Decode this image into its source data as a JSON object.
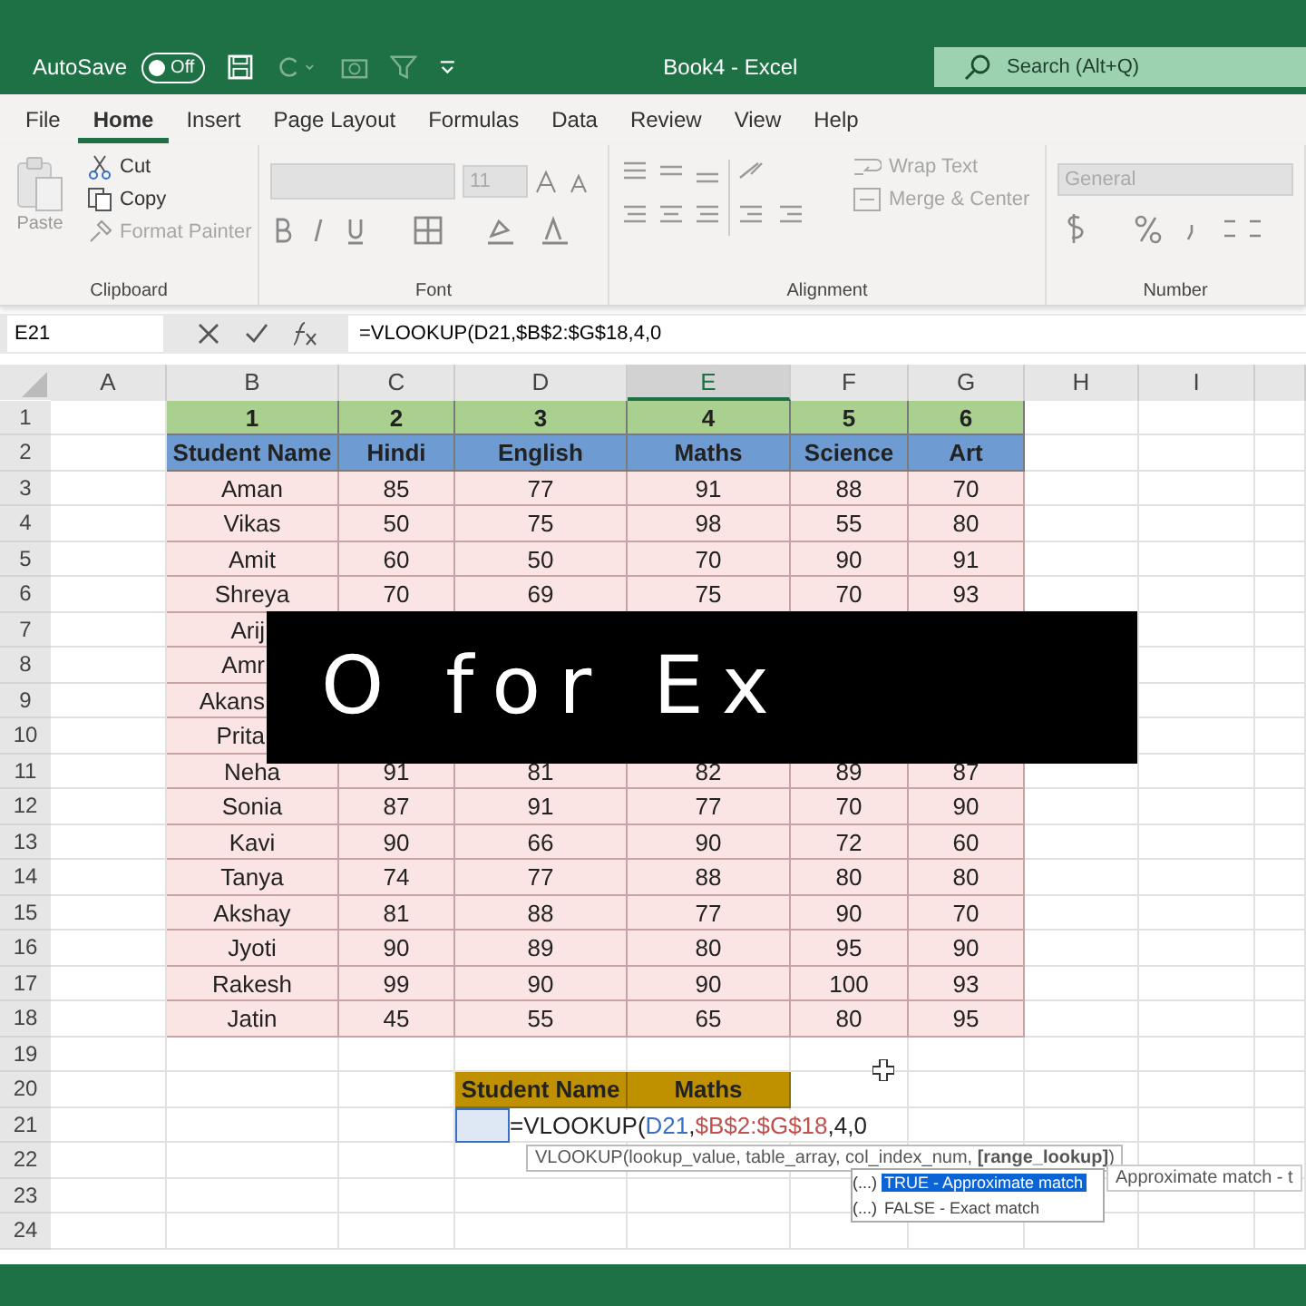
{
  "title_bar": {
    "autosave_label": "AutoSave",
    "autosave_state": "Off",
    "autosave_on": false,
    "title": "Book4 - Excel",
    "search_placeholder": "Search (Alt+Q)"
  },
  "tabs": [
    {
      "label": "File",
      "selected": false
    },
    {
      "label": "Home",
      "selected": true
    },
    {
      "label": "Insert",
      "selected": false
    },
    {
      "label": "Page Layout",
      "selected": false
    },
    {
      "label": "Formulas",
      "selected": false
    },
    {
      "label": "Data",
      "selected": false
    },
    {
      "label": "Review",
      "selected": false
    },
    {
      "label": "View",
      "selected": false
    },
    {
      "label": "Help",
      "selected": false
    }
  ],
  "ribbon": {
    "clipboard": {
      "label": "Clipboard",
      "paste": "Paste",
      "cut": "Cut",
      "copy": "Copy",
      "format_painter": "Format Painter"
    },
    "font": {
      "label": "Font",
      "size": "11"
    },
    "alignment": {
      "label": "Alignment",
      "wrap_text": "Wrap Text",
      "merge": "Merge & Center"
    },
    "number": {
      "label": "Number",
      "format": "General"
    }
  },
  "formula_bar": {
    "name_box": "E21",
    "formula": "=VLOOKUP(D21,$B$2:$G$18,4,0"
  },
  "sheet": {
    "column_letters": [
      {
        "label": "A",
        "selected": false
      },
      {
        "label": "B",
        "selected": false
      },
      {
        "label": "C",
        "selected": false
      },
      {
        "label": "D",
        "selected": false
      },
      {
        "label": "E",
        "selected": true
      },
      {
        "label": "F",
        "selected": false
      },
      {
        "label": "G",
        "selected": false
      },
      {
        "label": "H",
        "selected": false
      },
      {
        "label": "I",
        "selected": false
      }
    ],
    "row_numbers": [
      "1",
      "2",
      "3",
      "4",
      "5",
      "6",
      "7",
      "8",
      "9",
      "10",
      "11",
      "12",
      "13",
      "14",
      "15",
      "16",
      "17",
      "18",
      "19",
      "20",
      "21",
      "22",
      "23",
      "24"
    ],
    "table": {
      "index_row": [
        "1",
        "2",
        "3",
        "4",
        "5",
        "6"
      ],
      "header": [
        "Student Name",
        "Hindi",
        "English",
        "Maths",
        "Science",
        "Art"
      ],
      "rows": [
        {
          "kind": "full",
          "cells": [
            "Aman",
            "85",
            "77",
            "91",
            "88",
            "70"
          ]
        },
        {
          "kind": "full",
          "cells": [
            "Vikas",
            "50",
            "75",
            "98",
            "55",
            "80"
          ]
        },
        {
          "kind": "full",
          "cells": [
            "Amit",
            "60",
            "50",
            "70",
            "90",
            "91"
          ]
        },
        {
          "kind": "full",
          "cells": [
            "Shreya",
            "70",
            "69",
            "75",
            "70",
            "93"
          ]
        },
        {
          "kind": "partial",
          "cells": [
            "Arij"
          ]
        },
        {
          "kind": "partial",
          "cells": [
            "Amr"
          ]
        },
        {
          "kind": "partial",
          "cells": [
            "Akans"
          ]
        },
        {
          "kind": "partial",
          "cells": [
            "Prita"
          ]
        },
        {
          "kind": "full",
          "cells": [
            "Neha",
            "91",
            "81",
            "82",
            "89",
            "87"
          ]
        },
        {
          "kind": "full",
          "cells": [
            "Sonia",
            "87",
            "91",
            "77",
            "70",
            "90"
          ]
        },
        {
          "kind": "full",
          "cells": [
            "Kavi",
            "90",
            "66",
            "90",
            "72",
            "60"
          ]
        },
        {
          "kind": "full",
          "cells": [
            "Tanya",
            "74",
            "77",
            "88",
            "80",
            "80"
          ]
        },
        {
          "kind": "full",
          "cells": [
            "Akshay",
            "81",
            "88",
            "77",
            "90",
            "70"
          ]
        },
        {
          "kind": "full",
          "cells": [
            "Jyoti",
            "90",
            "89",
            "80",
            "95",
            "90"
          ]
        },
        {
          "kind": "full",
          "cells": [
            "Rakesh",
            "99",
            "90",
            "90",
            "100",
            "93"
          ]
        },
        {
          "kind": "full",
          "cells": [
            "Jatin",
            "45",
            "55",
            "65",
            "80",
            "95"
          ]
        }
      ]
    },
    "lookup_header": [
      "Student Name",
      "Maths"
    ],
    "cell_formula": {
      "prefix": "=VLOOKUP(",
      "lookup_ref": {
        "text": "D21",
        "color": "#3a6fc4"
      },
      "separator": ",",
      "range_ref": {
        "text": "$B$2:$G$18",
        "color": "#c0504d"
      },
      "suffix": ",4,0",
      "color": "#222222"
    },
    "tooltip": "VLOOKUP(lookup_value, table_array, col_index_num, **[range_lookup]**)",
    "autocomplete": [
      {
        "mark": "(...)",
        "label": "TRUE - Approximate match",
        "selected": true
      },
      {
        "mark": "(...)",
        "label": "FALSE - Exact match",
        "selected": false
      }
    ],
    "side_tip": "Approximate match - t"
  },
  "caption": "O for Ex"
}
